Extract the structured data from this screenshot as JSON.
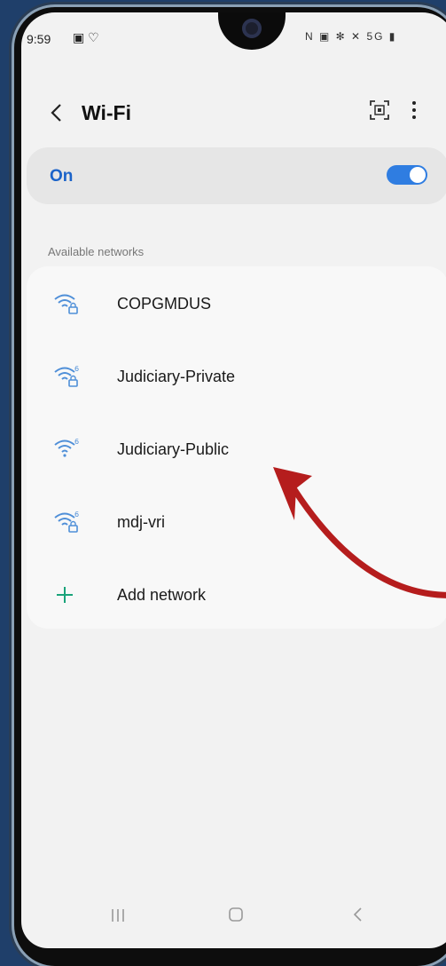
{
  "status_bar": {
    "time": "9:59",
    "left_icons": "▣ ♡",
    "right_icons": "N ▣ ✻ ✕ 5G ▮"
  },
  "header": {
    "title": "Wi-Fi"
  },
  "wifi_toggle": {
    "label": "On",
    "state": "on",
    "accent_color": "#2f7de1"
  },
  "section": {
    "label": "Available networks"
  },
  "networks": [
    {
      "name": "COPGMDUS",
      "icon": "wifi-lock-icon"
    },
    {
      "name": "Judiciary-Private",
      "icon": "wifi6-lock-icon"
    },
    {
      "name": "Judiciary-Public",
      "icon": "wifi6-icon"
    },
    {
      "name": "mdj-vri",
      "icon": "wifi6-lock-icon"
    }
  ],
  "add_network": {
    "label": "Add network",
    "icon": "plus-icon",
    "icon_color": "#1aa37a"
  },
  "annotation": {
    "arrow_color": "#b51d1d"
  }
}
